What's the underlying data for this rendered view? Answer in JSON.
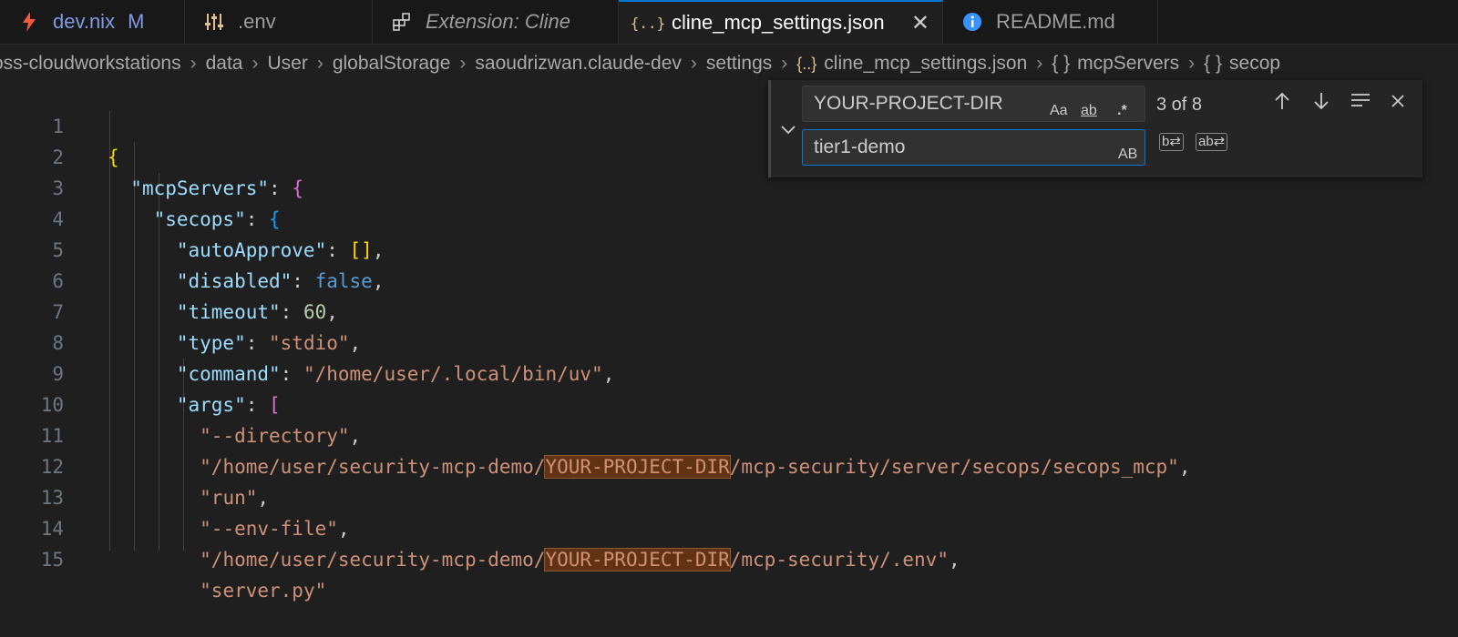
{
  "tabs": [
    {
      "label": "dev.nix",
      "badge": "M",
      "icon": "flash-icon"
    },
    {
      "label": ".env",
      "icon": "settings-sliders-icon"
    },
    {
      "label": "Extension: Cline",
      "icon": "extensions-icon"
    },
    {
      "label": "cline_mcp_settings.json",
      "icon": "json-braces-icon",
      "active": true
    },
    {
      "label": "README.md",
      "icon": "info-icon"
    }
  ],
  "breadcrumb": [
    "oss-cloudworkstations",
    "data",
    "User",
    "globalStorage",
    "saoudrizwan.claude-dev",
    "settings",
    "cline_mcp_settings.json",
    "mcpServers",
    "secop"
  ],
  "find": {
    "search_value": "YOUR-PROJECT-DIR",
    "replace_value": "tier1-demo",
    "match_case_label": "Aa",
    "whole_word_label": "ab",
    "regex_label": ".*",
    "preserve_case_label": "AB",
    "count": "3 of 8"
  },
  "line_numbers": [
    "1",
    "2",
    "3",
    "4",
    "5",
    "6",
    "7",
    "8",
    "9",
    "10",
    "11",
    "12",
    "13",
    "14",
    "15"
  ],
  "code": {
    "l1_open": "{",
    "l2_key": "\"mcpServers\"",
    "l3_key": "\"secops\"",
    "l4_key": "\"autoApprove\"",
    "l4_val": "[]",
    "l5_key": "\"disabled\"",
    "l5_val": "false",
    "l6_key": "\"timeout\"",
    "l6_val": "60",
    "l7_key": "\"type\"",
    "l7_val": "\"stdio\"",
    "l8_key": "\"command\"",
    "l8_val": "\"/home/user/.local/bin/uv\"",
    "l9_key": "\"args\"",
    "l10_val": "\"--directory\"",
    "l11_pre": "\"/home/user/security-mcp-demo/",
    "l11_match": "YOUR-PROJECT-DIR",
    "l11_post": "/mcp-security/server/secops/secops_mcp\"",
    "l12_val": "\"run\"",
    "l13_val": "\"--env-file\"",
    "l14_pre": "\"/home/user/security-mcp-demo/",
    "l14_match": "YOUR-PROJECT-DIR",
    "l14_post": "/mcp-security/.env\"",
    "l15_val": "\"server.py\""
  }
}
